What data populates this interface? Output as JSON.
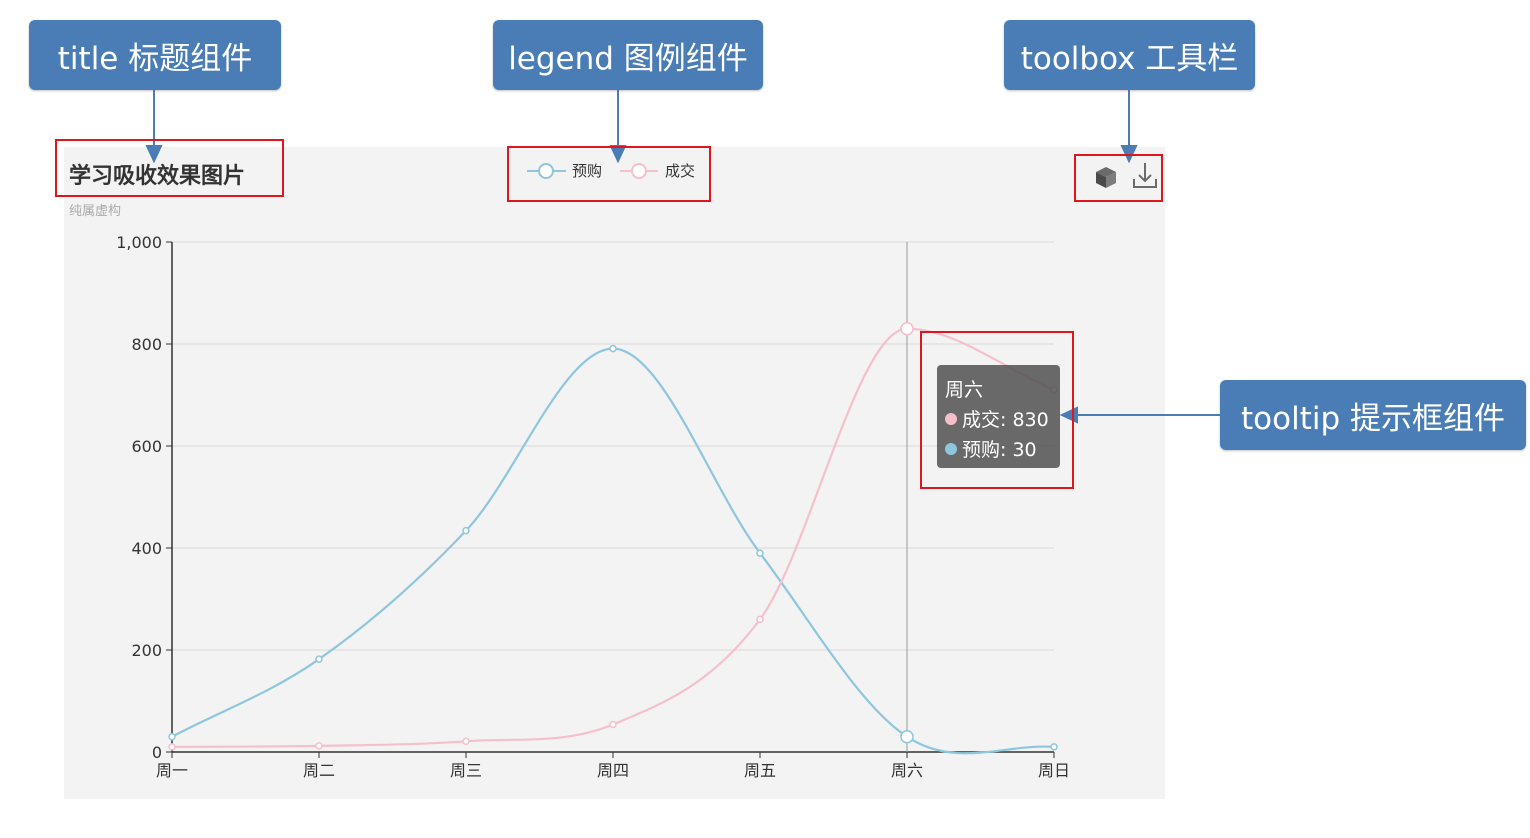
{
  "annotations": {
    "title_label": "title 标题组件",
    "legend_label": "legend 图例组件",
    "toolbox_label": "toolbox 工具栏",
    "tooltip_label": "tooltip 提示框组件"
  },
  "toolbox": {
    "icons": [
      "cube-icon",
      "download-icon"
    ]
  },
  "tooltip": {
    "title": "周六",
    "rows": [
      {
        "name": "成交",
        "value": "830",
        "text": "成交: 830"
      },
      {
        "name": "预购",
        "value": "30",
        "text": "预购: 30"
      }
    ]
  },
  "colors": {
    "series_prebuy": "#8ec6dd",
    "series_deal": "#f5c0cb",
    "annotation_blue": "#4a7db5",
    "highlight_red": "#e0161e"
  },
  "chart_data": {
    "type": "line",
    "title": "学习吸收效果图片",
    "subtitle": "纯属虚构",
    "legend_placement": "top-center",
    "categories": [
      "周一",
      "周二",
      "周三",
      "周四",
      "周五",
      "周六",
      "周日"
    ],
    "series": [
      {
        "name": "预购",
        "values": [
          30,
          182,
          434,
          791,
          390,
          30,
          10
        ]
      },
      {
        "name": "成交",
        "values": [
          10,
          12,
          21,
          54,
          260,
          830,
          710
        ]
      }
    ],
    "ylim": [
      0,
      1000
    ],
    "yticks": [
      0,
      200,
      400,
      600,
      800,
      1000
    ],
    "ytick_labels": [
      "0",
      "200",
      "400",
      "600",
      "800",
      "1,000"
    ],
    "grid": true,
    "smooth": true
  }
}
